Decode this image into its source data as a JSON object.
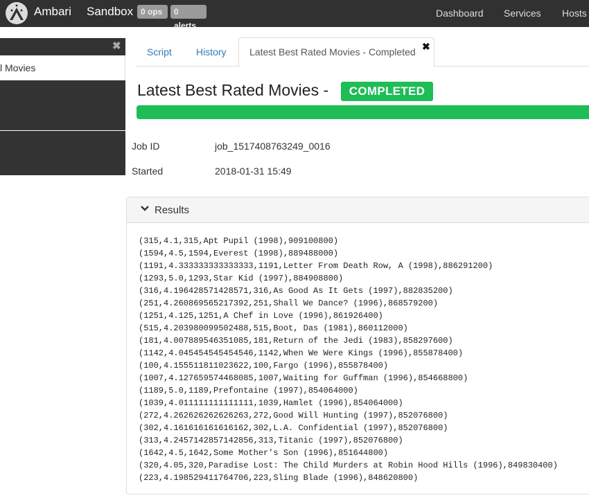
{
  "navbar": {
    "brand": "Ambari",
    "cluster_name": "Sandbox",
    "ops_badge": "0 ops",
    "alerts_badge": "0 alerts",
    "links": [
      "Dashboard",
      "Services",
      "Hosts"
    ]
  },
  "sidebar": {
    "close_glyph": "✖",
    "active_item": "l Movies"
  },
  "tabs": {
    "script": "Script",
    "history": "History",
    "active": "Latest Best Rated Movies - Completed",
    "close_glyph": "✖"
  },
  "job": {
    "title": "Latest Best Rated Movies -",
    "status": "COMPLETED",
    "progress_percent": 100,
    "job_id_label": "Job ID",
    "job_id": "job_1517408763249_0016",
    "started_label": "Started",
    "started": "2018-01-31 15:49"
  },
  "results": {
    "heading": "Results",
    "lines": [
      "(315,4.1,315,Apt Pupil (1998),909100800)",
      "(1594,4.5,1594,Everest (1998),889488000)",
      "(1191,4.333333333333333,1191,Letter From Death Row, A (1998),886291200)",
      "(1293,5.0,1293,Star Kid (1997),884908800)",
      "(316,4.196428571428571,316,As Good As It Gets (1997),882835200)",
      "(251,4.260869565217392,251,Shall We Dance? (1996),868579200)",
      "(1251,4.125,1251,A Chef in Love (1996),861926400)",
      "(515,4.203980099502488,515,Boot, Das (1981),860112000)",
      "(181,4.007889546351085,181,Return of the Jedi (1983),858297600)",
      "(1142,4.045454545454546,1142,When We Were Kings (1996),855878400)",
      "(100,4.155511811023622,100,Fargo (1996),855878400)",
      "(1007,4.127659574468085,1007,Waiting for Guffman (1996),854668800)",
      "(1189,5.0,1189,Prefontaine (1997),854064000)",
      "(1039,4.011111111111111,1039,Hamlet (1996),854064000)",
      "(272,4.262626262626263,272,Good Will Hunting (1997),852076800)",
      "(302,4.161616161616162,302,L.A. Confidential (1997),852076800)",
      "(313,4.2457142857142856,313,Titanic (1997),852076800)",
      "(1642,4.5,1642,Some Mother's Son (1996),851644800)",
      "(320,4.05,320,Paradise Lost: The Child Murders at Robin Hood Hills (1996),849830400)",
      "(223,4.198529411764706,223,Sling Blade (1996),848620800)"
    ]
  },
  "colors": {
    "navbar_bg": "#313131",
    "success": "#1ebd56",
    "link": "#337ab7"
  }
}
